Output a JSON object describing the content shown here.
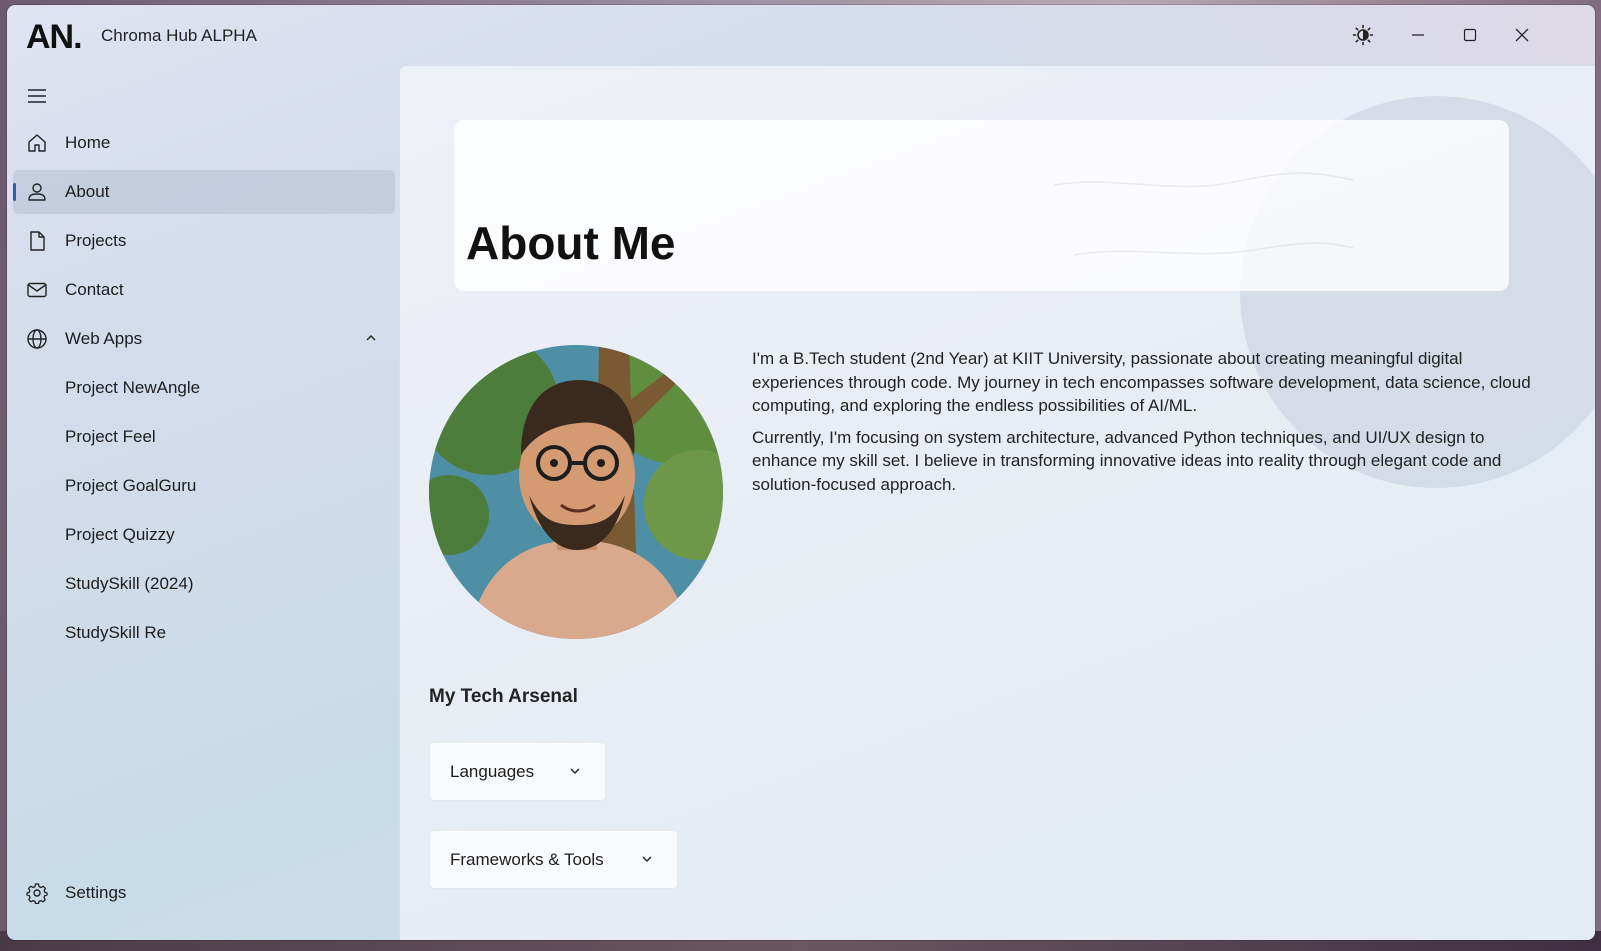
{
  "window": {
    "logo": "AN.",
    "title": "Chroma Hub ALPHA"
  },
  "caption_buttons": {
    "theme_icon": "brightness-icon",
    "minimize_icon": "minimize-icon",
    "maximize_icon": "maximize-icon",
    "close_icon": "close-icon"
  },
  "sidebar": {
    "menu_icon": "hamburger-icon",
    "items": [
      {
        "label": "Home",
        "icon": "home-icon"
      },
      {
        "label": "About",
        "icon": "person-icon",
        "selected": true
      },
      {
        "label": "Projects",
        "icon": "document-icon"
      },
      {
        "label": "Contact",
        "icon": "mail-icon"
      },
      {
        "label": "Web Apps",
        "icon": "globe-icon",
        "expanded": true
      }
    ],
    "sub_items": [
      {
        "label": "Project NewAngle"
      },
      {
        "label": "Project Feel"
      },
      {
        "label": "Project GoalGuru"
      },
      {
        "label": "Project Quizzy"
      },
      {
        "label": "StudySkill (2024)"
      },
      {
        "label": "StudySkill Re"
      }
    ],
    "footer": {
      "label": "Settings",
      "icon": "gear-icon"
    }
  },
  "main": {
    "title": "About Me",
    "bio": [
      "I'm a B.Tech student (2nd Year) at KIIT University, passionate about creating meaningful digital experiences through code. My journey in tech encompasses software development, data science, cloud computing, and exploring the endless possibilities of AI/ML.",
      "Currently, I'm focusing on system architecture, advanced Python techniques, and UI/UX design to enhance my skill set. I believe in transforming innovative ideas into reality through elegant code and solution-focused approach."
    ],
    "section_title": "My Tech Arsenal",
    "expanders": [
      {
        "label": "Languages"
      },
      {
        "label": "Frameworks & Tools"
      }
    ]
  },
  "colors": {
    "accent": "#2d5fa8",
    "text": "#1d1d1d"
  }
}
